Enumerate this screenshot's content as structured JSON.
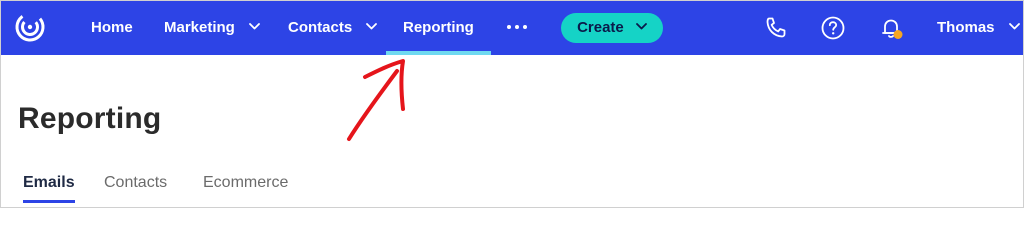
{
  "nav": {
    "items": [
      {
        "label": "Home"
      },
      {
        "label": "Marketing"
      },
      {
        "label": "Contacts"
      },
      {
        "label": "Reporting"
      }
    ],
    "create_label": "Create",
    "user_name": "Thomas"
  },
  "page": {
    "title": "Reporting",
    "tabs": [
      {
        "label": "Emails"
      },
      {
        "label": "Contacts"
      },
      {
        "label": "Ecommerce"
      }
    ]
  },
  "colors": {
    "topbar": "#2d44e6",
    "active_indicator": "#6fd9f0",
    "create_button": "#15d3c6",
    "notification_dot": "#f5a623",
    "annotation": "#e5151b"
  },
  "icons": [
    "logo-icon",
    "chevron-down-icon",
    "more-horizontal-icon",
    "phone-icon",
    "help-icon",
    "bell-icon",
    "annotation-arrow"
  ]
}
